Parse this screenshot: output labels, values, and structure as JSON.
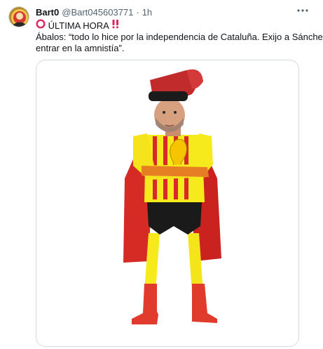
{
  "tweet": {
    "author_name": "Bart0",
    "handle": "@Bart045603771",
    "separator": "·",
    "time": "1h",
    "headline": "ÚLTIMA HORA",
    "body_line1": "Ábalos: “todo lo hice por la independencia de Cataluña. Exijo a Sánchez",
    "body_line2": "entrar en la amnistía”.",
    "icons": {
      "headline_prefix": "hollow-red-circle-icon",
      "headline_suffix": "double-exclamation-icon",
      "more": "more-options-icon"
    },
    "colors": {
      "text": "#0f1419",
      "secondary": "#536471",
      "flag_red": "#d9272b",
      "flag_yellow": "#f7ea1c"
    }
  }
}
